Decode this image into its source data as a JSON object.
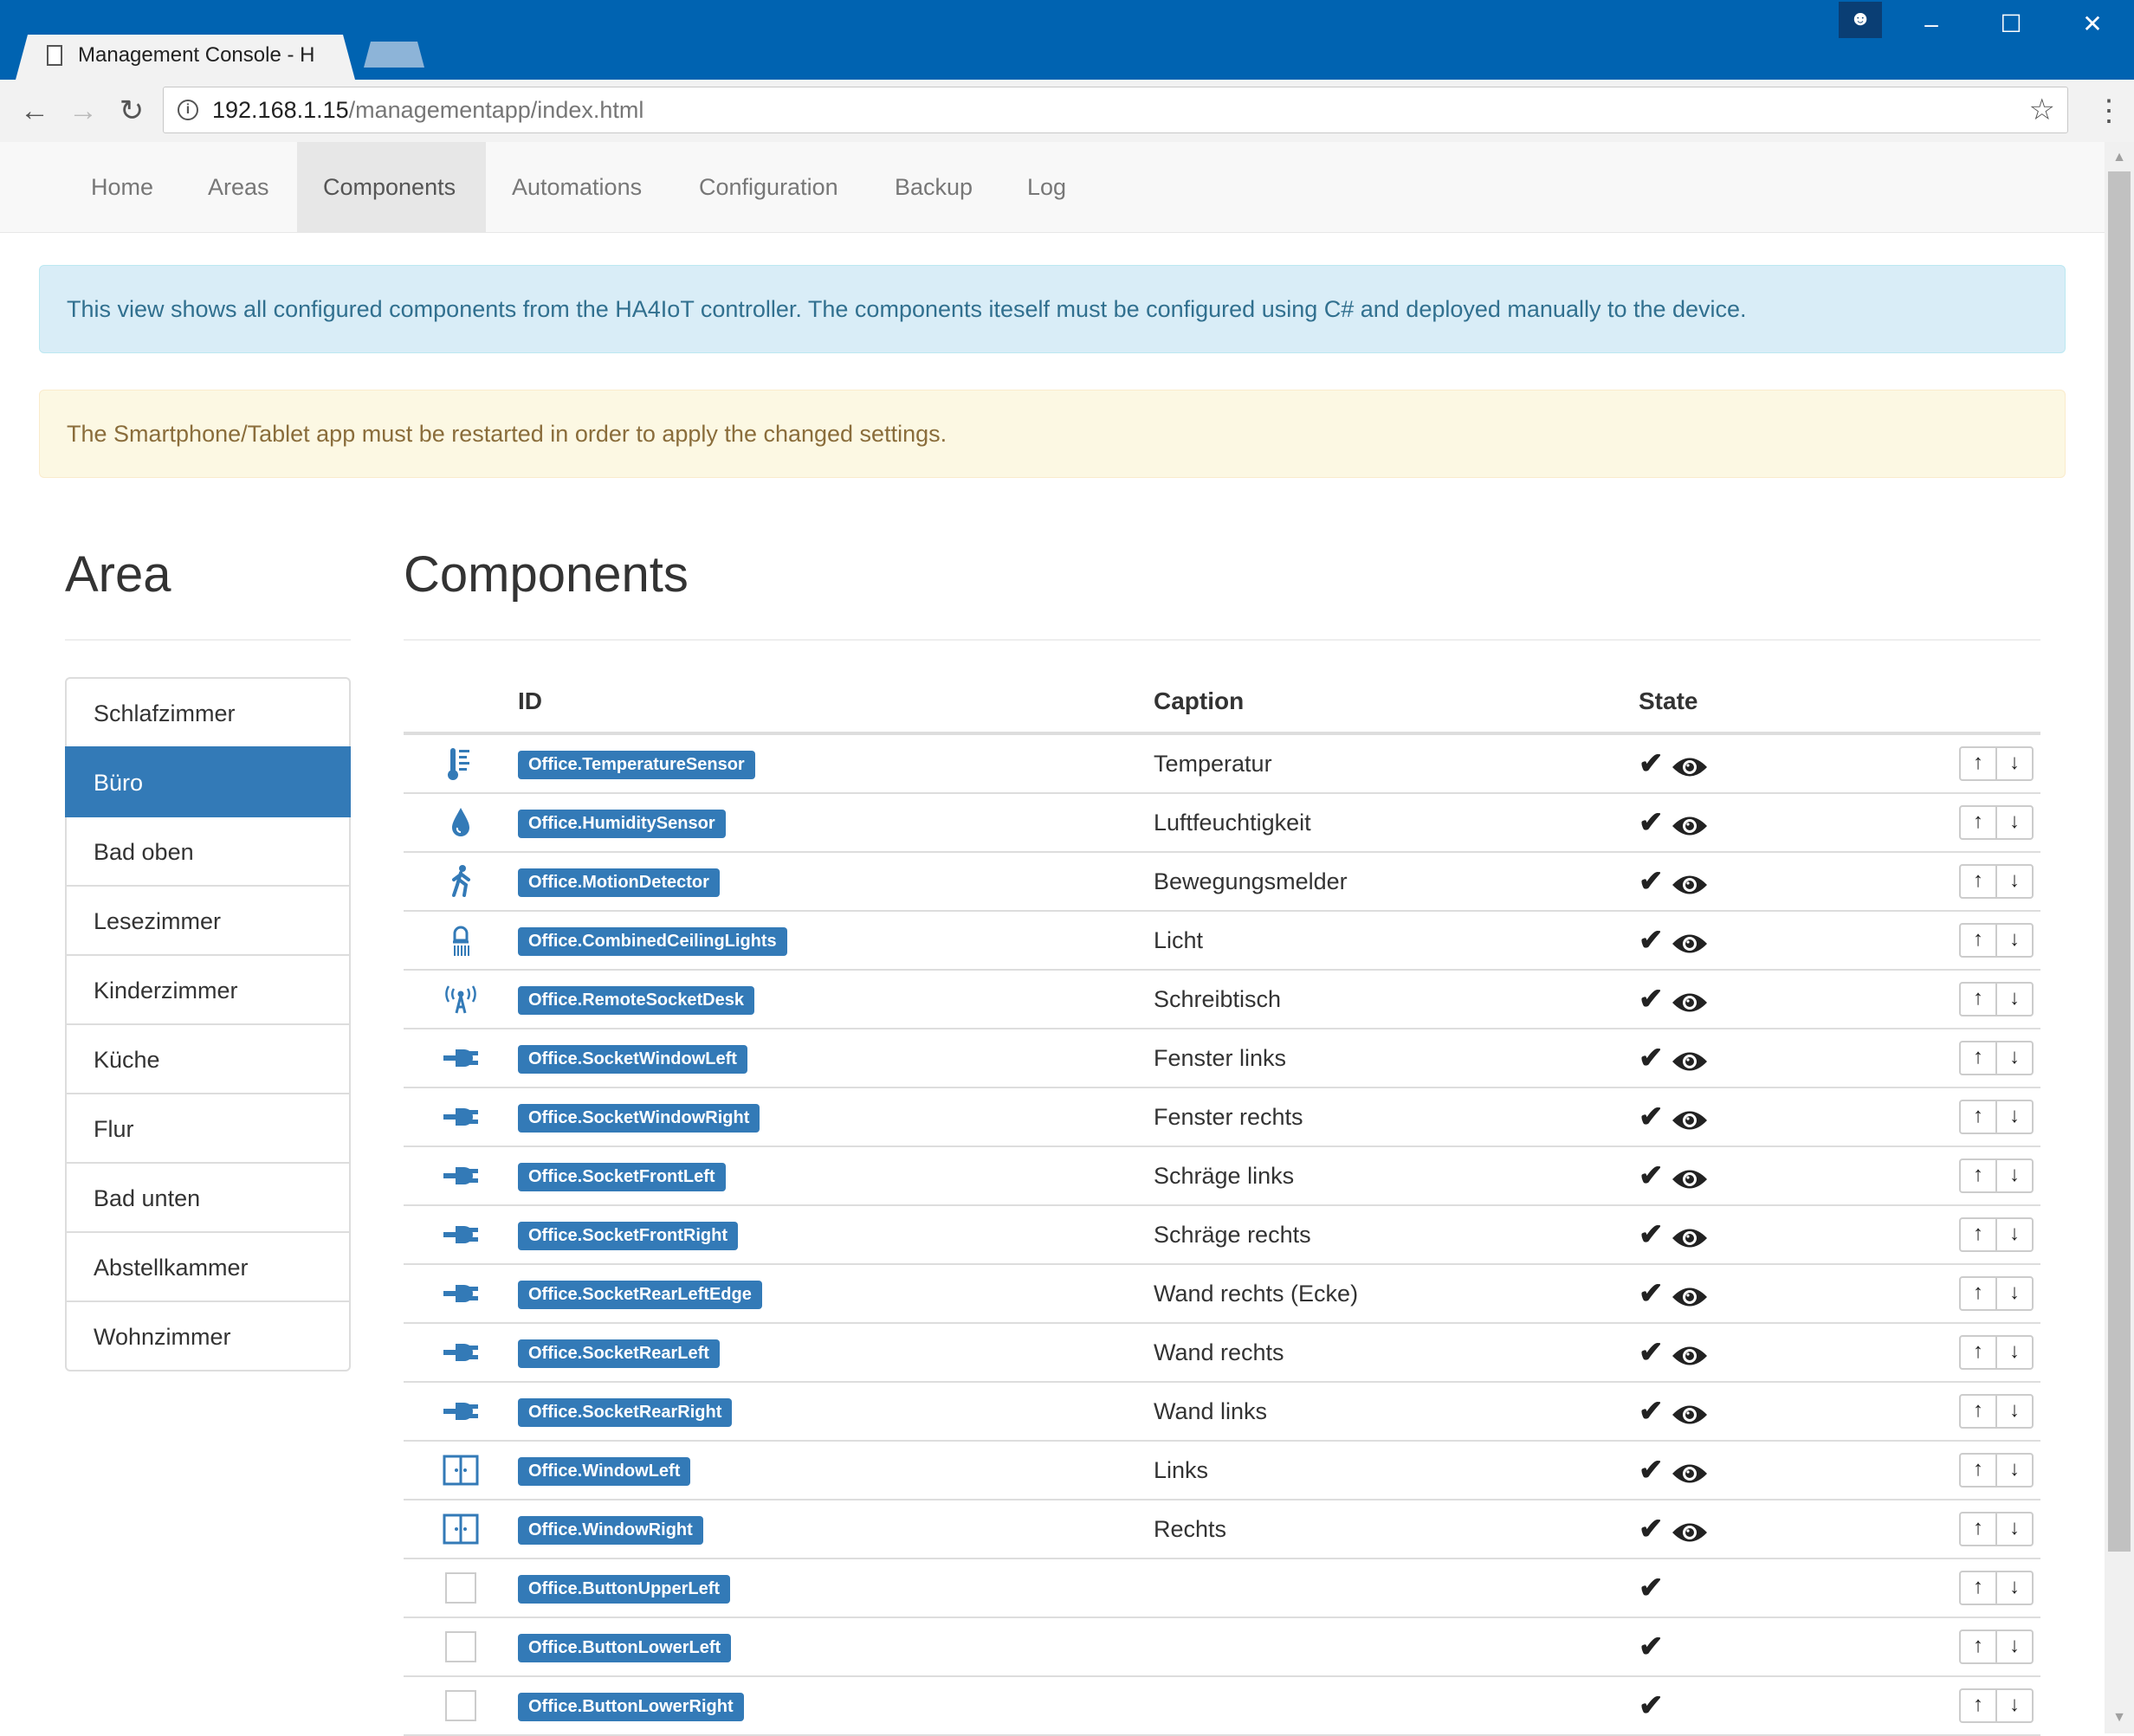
{
  "browser": {
    "tab_title": "Management Console - H",
    "url_host": "192.168.1.15",
    "url_path": "/managementapp/index.html",
    "window_controls": [
      "–",
      "☐",
      "✕"
    ]
  },
  "nav": {
    "items": [
      {
        "label": "Home"
      },
      {
        "label": "Areas"
      },
      {
        "label": "Components",
        "active": true
      },
      {
        "label": "Automations"
      },
      {
        "label": "Configuration"
      },
      {
        "label": "Backup"
      },
      {
        "label": "Log"
      }
    ]
  },
  "alerts": {
    "info": "This view shows all configured components from the HA4IoT controller. The components iteself must be configured using C# and deployed manually to the device.",
    "warning": "The Smartphone/Tablet app must be restarted in order to apply the changed settings."
  },
  "area_panel": {
    "title": "Area",
    "items": [
      "Schlafzimmer",
      "Büro",
      "Bad oben",
      "Lesezimmer",
      "Kinderzimmer",
      "Küche",
      "Flur",
      "Bad unten",
      "Abstellkammer",
      "Wohnzimmer"
    ],
    "active_index": 1
  },
  "components_panel": {
    "title": "Components",
    "columns": {
      "id": "ID",
      "caption": "Caption",
      "state": "State"
    },
    "rows": [
      {
        "icon": "thermometer-icon",
        "id": "Office.TemperatureSensor",
        "caption": "Temperatur",
        "enabled": true,
        "visible": true
      },
      {
        "icon": "droplet-icon",
        "id": "Office.HumiditySensor",
        "caption": "Luftfeuchtigkeit",
        "enabled": true,
        "visible": true
      },
      {
        "icon": "walking-person-icon",
        "id": "Office.MotionDetector",
        "caption": "Bewegungsmelder",
        "enabled": true,
        "visible": true
      },
      {
        "icon": "lamp-icon",
        "id": "Office.CombinedCeilingLights",
        "caption": "Licht",
        "enabled": true,
        "visible": true
      },
      {
        "icon": "antenna-icon",
        "id": "Office.RemoteSocketDesk",
        "caption": "Schreibtisch",
        "enabled": true,
        "visible": true
      },
      {
        "icon": "plug-icon",
        "id": "Office.SocketWindowLeft",
        "caption": "Fenster links",
        "enabled": true,
        "visible": true
      },
      {
        "icon": "plug-icon",
        "id": "Office.SocketWindowRight",
        "caption": "Fenster rechts",
        "enabled": true,
        "visible": true
      },
      {
        "icon": "plug-icon",
        "id": "Office.SocketFrontLeft",
        "caption": "Schräge links",
        "enabled": true,
        "visible": true
      },
      {
        "icon": "plug-icon",
        "id": "Office.SocketFrontRight",
        "caption": "Schräge rechts",
        "enabled": true,
        "visible": true
      },
      {
        "icon": "plug-icon",
        "id": "Office.SocketRearLeftEdge",
        "caption": "Wand rechts (Ecke)",
        "enabled": true,
        "visible": true
      },
      {
        "icon": "plug-icon",
        "id": "Office.SocketRearLeft",
        "caption": "Wand rechts",
        "enabled": true,
        "visible": true
      },
      {
        "icon": "plug-icon",
        "id": "Office.SocketRearRight",
        "caption": "Wand links",
        "enabled": true,
        "visible": true
      },
      {
        "icon": "window-icon",
        "id": "Office.WindowLeft",
        "caption": "Links",
        "enabled": true,
        "visible": true
      },
      {
        "icon": "window-icon",
        "id": "Office.WindowRight",
        "caption": "Rechts",
        "enabled": true,
        "visible": true
      },
      {
        "icon": "empty-icon",
        "id": "Office.ButtonUpperLeft",
        "caption": "",
        "enabled": true,
        "visible": false
      },
      {
        "icon": "empty-icon",
        "id": "Office.ButtonLowerLeft",
        "caption": "",
        "enabled": true,
        "visible": false
      },
      {
        "icon": "empty-icon",
        "id": "Office.ButtonLowerRight",
        "caption": "",
        "enabled": true,
        "visible": false
      }
    ]
  },
  "colors": {
    "titlebar": "#0063b1",
    "primary": "#337ab7",
    "info_bg": "#d9edf7",
    "warning_bg": "#fcf8e3"
  }
}
